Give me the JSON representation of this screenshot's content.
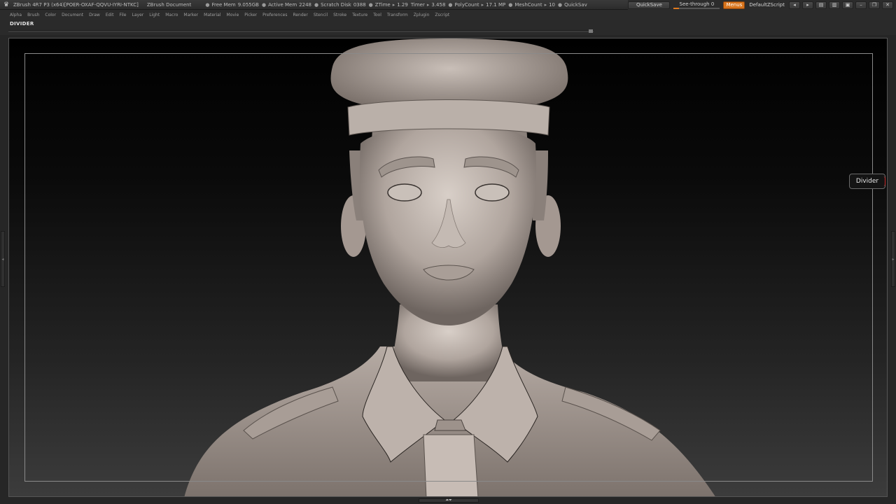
{
  "titlebar": {
    "app_title": "ZBrush 4R7 P3 (x64)[POER-OXAF-QQVU-IYRI-NTKC]",
    "document": "ZBrush Document",
    "stats": [
      {
        "label": "Free Mem",
        "value": "9.055GB"
      },
      {
        "label": "Active Mem",
        "value": "2248"
      },
      {
        "label": "Scratch Disk",
        "value": "0388"
      },
      {
        "label": "ZTime",
        "value": "1.29"
      },
      {
        "label": "Timer",
        "value": "3.458"
      },
      {
        "label": "PolyCount",
        "value": "17.1 MP"
      },
      {
        "label": "MeshCount",
        "value": "10"
      }
    ],
    "quicksave_trunc": "QuickSav",
    "quicksave_label": "QuickSave",
    "seethrough_label": "See-through",
    "seethrough_value": "0",
    "menus_label": "Menus",
    "script_label": "DefaultZScript"
  },
  "menubar": {
    "items": [
      "Alpha",
      "Brush",
      "Color",
      "Document",
      "Draw",
      "Edit",
      "File",
      "Layer",
      "Light",
      "Macro",
      "Marker",
      "Material",
      "Movie",
      "Picker",
      "Preferences",
      "Render",
      "Stencil",
      "Stroke",
      "Texture",
      "Tool",
      "Transform",
      "Zplugin",
      "Zscript"
    ]
  },
  "shelf": {
    "label": "DIVIDER"
  },
  "tooltip": {
    "text": "Divider"
  },
  "colors": {
    "accent": "#d8741c",
    "canvas_top": "#000000",
    "canvas_bottom": "#3c3c3c",
    "model": "#b4aaa3"
  },
  "icons": [
    "zbrush-logo-icon",
    "scroll-left-icon",
    "scroll-right-icon",
    "layout-icon",
    "lock-icon",
    "minimize-icon",
    "restore-icon",
    "close-icon"
  ]
}
